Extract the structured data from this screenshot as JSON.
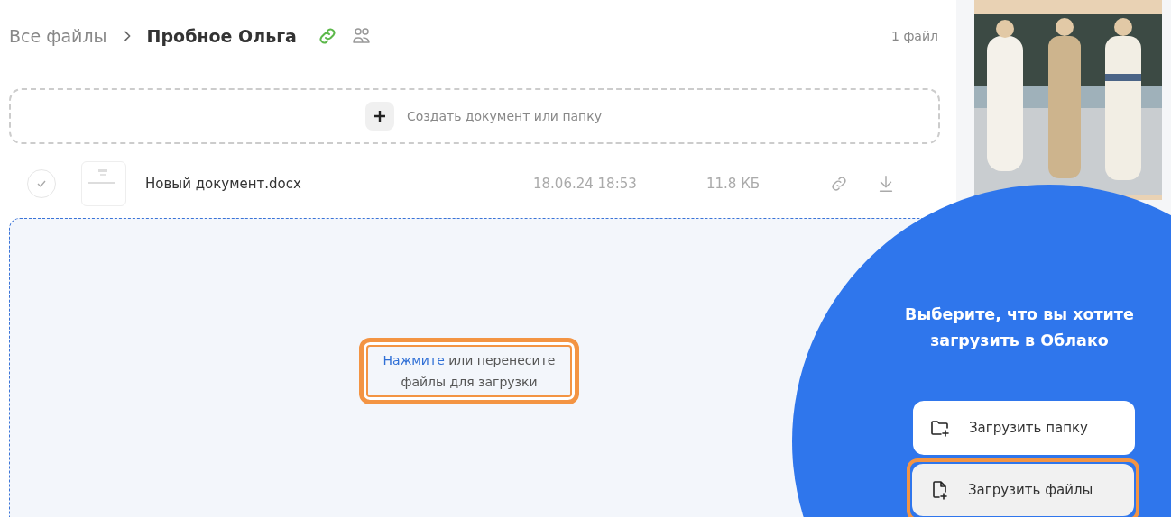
{
  "breadcrumb": [
    {
      "label": "Все файлы",
      "current": false
    },
    {
      "label": "Пробное Ольга",
      "current": true
    }
  ],
  "file_count": "1 файл",
  "create": {
    "label": "Создать документ или папку"
  },
  "files": [
    {
      "name": "Новый документ.docx",
      "date": "18.06.24 18:53",
      "size": "11.8 КБ",
      "selected": false
    }
  ],
  "dropzone": {
    "link": "Нажмите",
    "text": " или перенесите файлы для загрузки",
    "highlighted": true
  },
  "upload_panel": {
    "title": "Выберите, что вы хотите загрузить в Облако",
    "options": [
      {
        "kind": "folder",
        "label": "Загрузить папку",
        "highlighted": false
      },
      {
        "kind": "files",
        "label": "Загрузить файлы",
        "highlighted": true
      }
    ]
  }
}
